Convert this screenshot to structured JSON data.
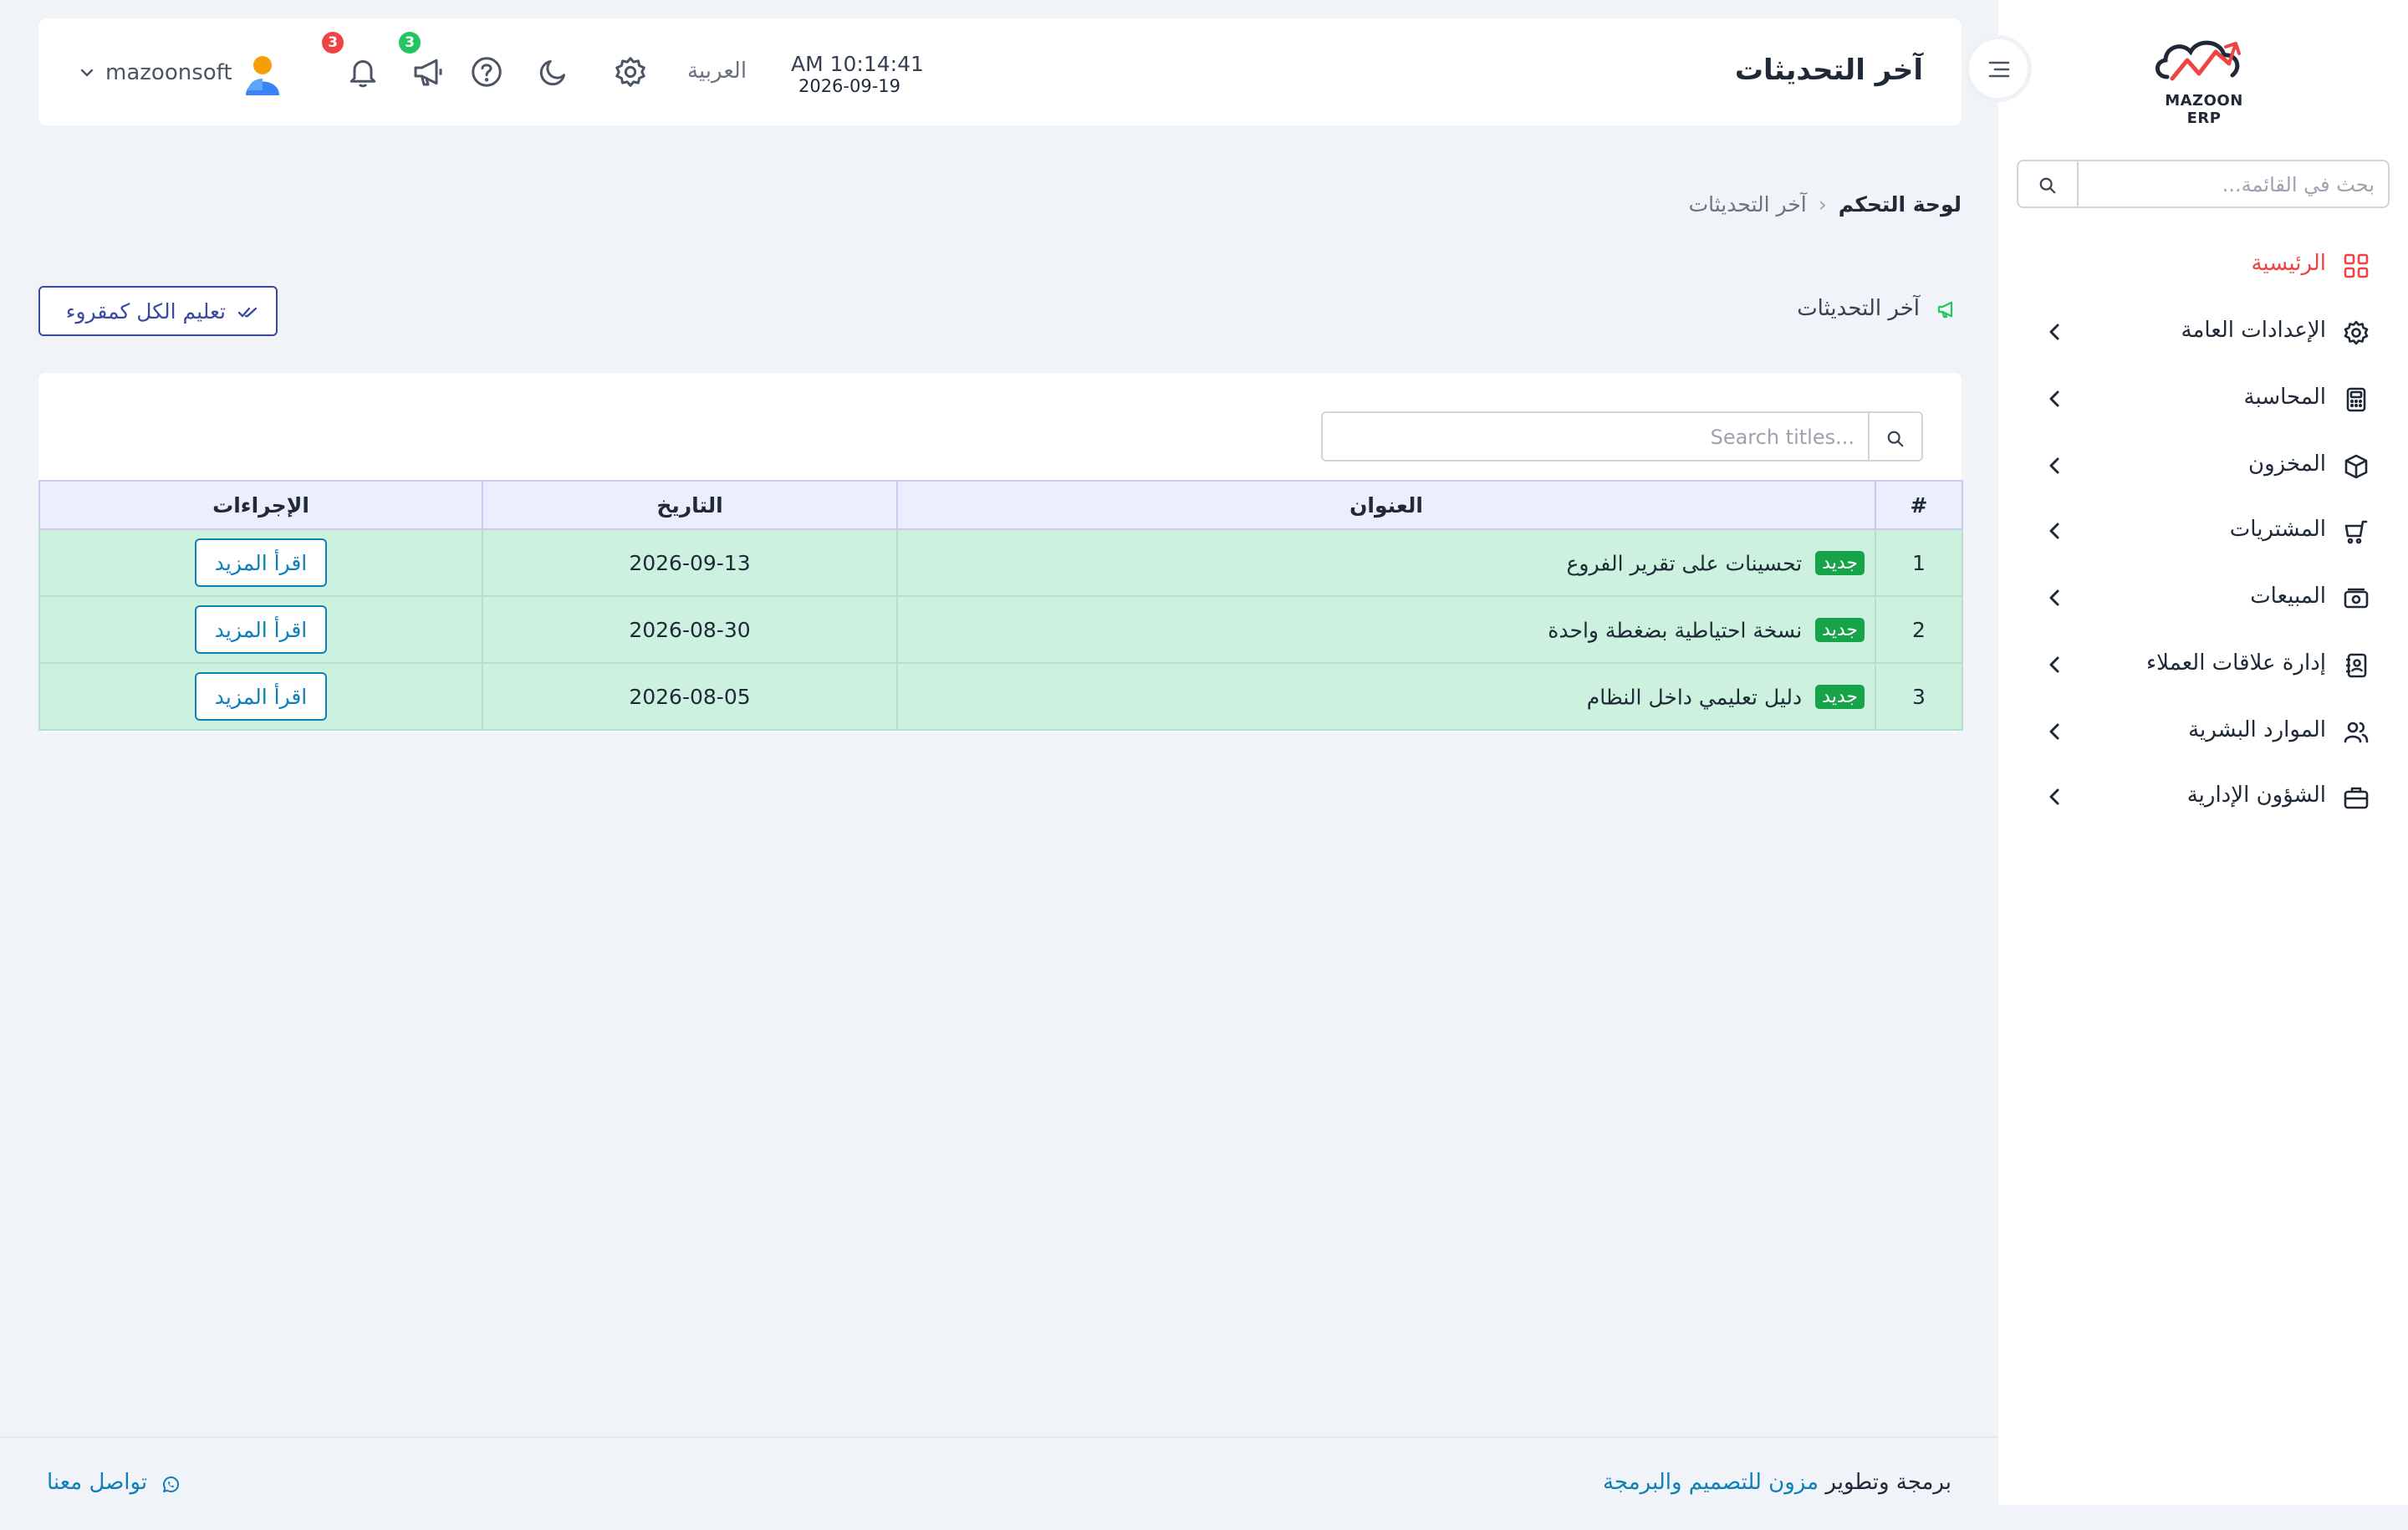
{
  "brand": {
    "logo_text": "MAZOON ERP"
  },
  "sidebar": {
    "search_placeholder": "بحث في القائمة...",
    "items": [
      {
        "label": "الرئيسية",
        "icon": "grid-icon",
        "active": true
      },
      {
        "label": "الإعدادات العامة",
        "icon": "gear-icon"
      },
      {
        "label": "المحاسبة",
        "icon": "calculator-icon"
      },
      {
        "label": "المخزون",
        "icon": "box-icon"
      },
      {
        "label": "المشتريات",
        "icon": "cart-icon"
      },
      {
        "label": "المبيعات",
        "icon": "cash-icon"
      },
      {
        "label": "إدارة علاقات العملاء",
        "icon": "contacts-book-icon"
      },
      {
        "label": "الموارد البشرية",
        "icon": "users-icon"
      },
      {
        "label": "الشؤون الإدارية",
        "icon": "briefcase-icon"
      }
    ]
  },
  "header": {
    "title": "آخر التحديثات",
    "time": "AM 10:14:41",
    "date": "2026-09-19",
    "language": "العربية",
    "notifications_count": "3",
    "announcements_count": "3",
    "username": "mazoonsoft"
  },
  "breadcrumb": {
    "root": "لوحة التحكم",
    "separator": "‹",
    "current": "آخر التحديثات"
  },
  "section": {
    "title": "آخر التحديثات",
    "mark_all_label": "تعليم الكل كمقروء"
  },
  "table": {
    "search_placeholder": "Search titles...",
    "columns": [
      "#",
      "العنوان",
      "التاريخ",
      "الإجراءات"
    ],
    "new_badge_label": "جديد",
    "read_more_label": "اقرأ المزيد",
    "rows": [
      {
        "index": "1",
        "title": "تحسينات على تقرير الفروع",
        "date": "2026-09-13"
      },
      {
        "index": "2",
        "title": "نسخة احتياطية بضغطة واحدة",
        "date": "2026-08-30"
      },
      {
        "index": "3",
        "title": "دليل تعليمي داخل النظام",
        "date": "2026-08-05"
      }
    ]
  },
  "footer": {
    "credit_prefix": "برمجة وتطوير",
    "company": "مزون للتصميم والبرمجة",
    "contact": "تواصل معنا"
  },
  "colors": {
    "accent": "#3b4a9f",
    "link": "#0e7fb8",
    "active_nav": "#ef4444",
    "row_highlight": "#cdf1df",
    "header_row": "#eceefe",
    "badge_new": "#16a34a"
  }
}
